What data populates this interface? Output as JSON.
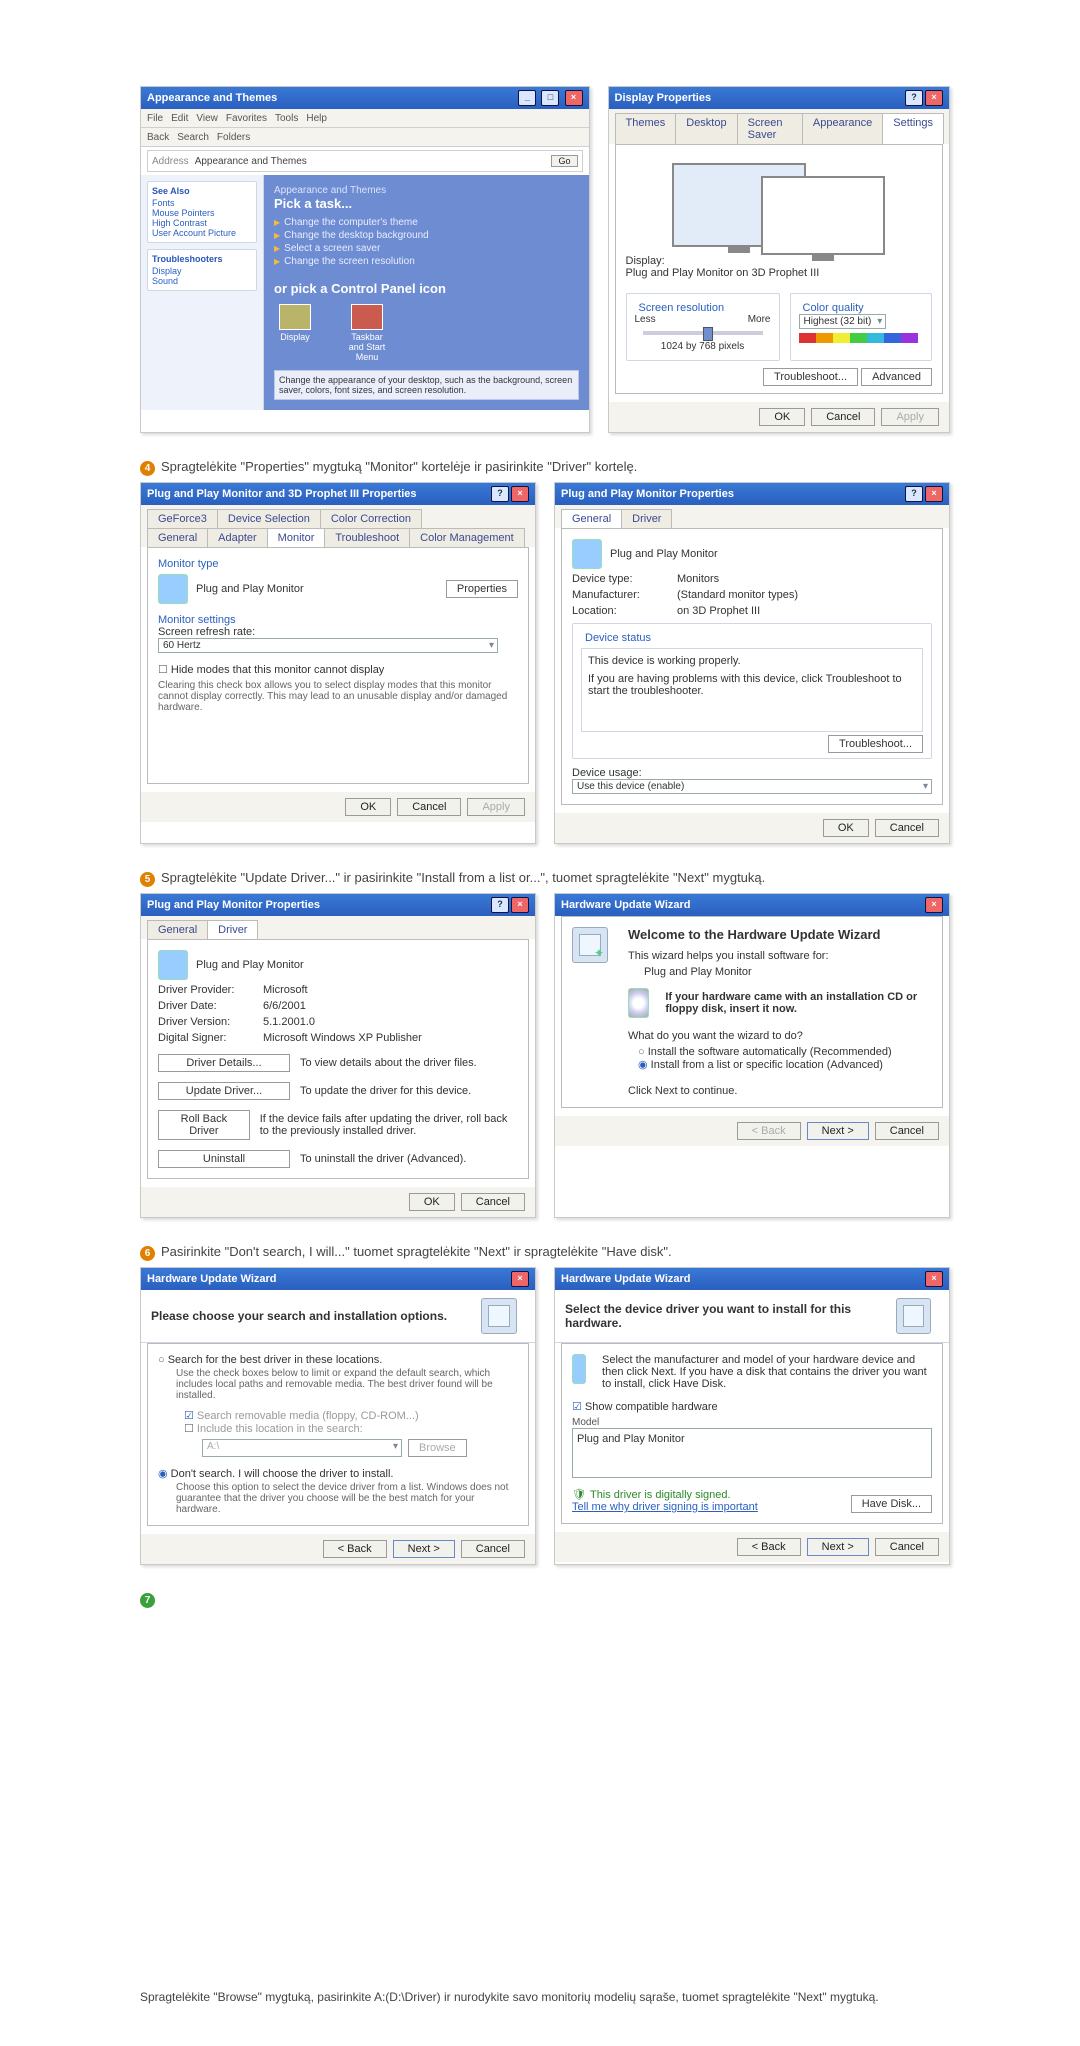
{
  "step4": "Spragtelėkite \"Properties\" mygtuką \"Monitor\" kortelėje ir pasirinkite \"Driver\" kortelę.",
  "step5": "Spragtelėkite \"Update Driver...\" ir pasirinkite \"Install from a list or...\", tuomet spragtelėkite \"Next\" mygtuką.",
  "step6": "Pasirinkite \"Don't search, I will...\" tuomet spragtelėkite \"Next\" ir spragtelėkite \"Have disk\".",
  "step7_footer": "Spragtelėkite \"Browse\" mygtuką, pasirinkite A:(D:\\Driver) ir nurodykite savo monitorių modelių sąraše, tuomet spragtelėkite \"Next\" mygtuką.",
  "explorer": {
    "title": "Appearance and Themes",
    "menu": [
      "File",
      "Edit",
      "View",
      "Favorites",
      "Tools",
      "Help"
    ],
    "tb": [
      "Back",
      "Search",
      "Folders"
    ],
    "addr_label": "Address",
    "addr": "Appearance and Themes",
    "go": "Go",
    "see_also": "See Also",
    "see_items": [
      "Fonts",
      "Mouse Pointers",
      "High Contrast",
      "User Account Picture"
    ],
    "trouble": "Troubleshooters",
    "trouble_items": [
      "Display",
      "Sound"
    ],
    "heading": "Appearance and Themes",
    "pick": "Pick a task...",
    "tasks": [
      "Change the computer's theme",
      "Change the desktop background",
      "Select a screen saver",
      "Change the screen resolution"
    ],
    "or": "or pick a Control Panel icon",
    "icons": [
      "Display",
      "Taskbar and Start Menu"
    ],
    "tip_icon": "Change the appearance of your desktop, such as the background, screen saver, colors, font sizes, and screen resolution."
  },
  "display_props": {
    "title": "Display Properties",
    "tabs": [
      "Themes",
      "Desktop",
      "Screen Saver",
      "Appearance",
      "Settings"
    ],
    "display": "Display:",
    "display_val": "Plug and Play Monitor on 3D Prophet III",
    "res": "Screen resolution",
    "less": "Less",
    "more": "More",
    "res_val": "1024 by 768 pixels",
    "cq": "Color quality",
    "cq_val": "Highest (32 bit)",
    "troubleshoot": "Troubleshoot...",
    "advanced": "Advanced",
    "ok": "OK",
    "cancel": "Cancel",
    "apply": "Apply"
  },
  "pnp_props": {
    "title": "Plug and Play Monitor and 3D Prophet III Properties",
    "tabs_top": [
      "GeForce3",
      "Device Selection",
      "Color Correction"
    ],
    "tabs_bot": [
      "General",
      "Adapter",
      "Monitor",
      "Troubleshoot",
      "Color Management"
    ],
    "mt": "Monitor type",
    "mt_val": "Plug and Play Monitor",
    "props": "Properties",
    "ms": "Monitor settings",
    "srr": "Screen refresh rate:",
    "srr_val": "60 Hertz",
    "hide": "Hide modes that this monitor cannot display",
    "hide_note": "Clearing this check box allows you to select display modes that this monitor cannot display correctly. This may lead to an unusable display and/or damaged hardware.",
    "ok": "OK",
    "cancel": "Cancel",
    "apply": "Apply"
  },
  "pnp_mon": {
    "title": "Plug and Play Monitor Properties",
    "tabs": [
      "General",
      "Driver"
    ],
    "name": "Plug and Play Monitor",
    "dt": "Device type:",
    "dt_v": "Monitors",
    "mf": "Manufacturer:",
    "mf_v": "(Standard monitor types)",
    "loc": "Location:",
    "loc_v": "on 3D Prophet III",
    "ds": "Device status",
    "ds_v": "This device is working properly.",
    "ds_note": "If you are having problems with this device, click Troubleshoot to start the troubleshooter.",
    "tshoot": "Troubleshoot...",
    "du": "Device usage:",
    "du_v": "Use this device (enable)",
    "ok": "OK",
    "cancel": "Cancel"
  },
  "drv": {
    "title": "Plug and Play Monitor Properties",
    "tabs": [
      "General",
      "Driver"
    ],
    "name": "Plug and Play Monitor",
    "dp": "Driver Provider:",
    "dp_v": "Microsoft",
    "dd": "Driver Date:",
    "dd_v": "6/6/2001",
    "dv": "Driver Version:",
    "dv_v": "5.1.2001.0",
    "ds": "Digital Signer:",
    "ds_v": "Microsoft Windows XP Publisher",
    "b1": "Driver Details...",
    "b1t": "To view details about the driver files.",
    "b2": "Update Driver...",
    "b2t": "To update the driver for this device.",
    "b3": "Roll Back Driver",
    "b3t": "If the device fails after updating the driver, roll back to the previously installed driver.",
    "b4": "Uninstall",
    "b4t": "To uninstall the driver (Advanced).",
    "ok": "OK",
    "cancel": "Cancel"
  },
  "wiz1": {
    "title": "Hardware Update Wizard",
    "h": "Welcome to the Hardware Update Wizard",
    "sub": "This wizard helps you install software for:",
    "dev": "Plug and Play Monitor",
    "cd": "If your hardware came with an installation CD or floppy disk, insert it now.",
    "q": "What do you want the wizard to do?",
    "r1": "Install the software automatically (Recommended)",
    "r2": "Install from a list or specific location (Advanced)",
    "cont": "Click Next to continue.",
    "back": "< Back",
    "next": "Next >",
    "cancel": "Cancel"
  },
  "wiz2": {
    "title": "Hardware Update Wizard",
    "h": "Please choose your search and installation options.",
    "r1": "Search for the best driver in these locations.",
    "r1_note": "Use the check boxes below to limit or expand the default search, which includes local paths and removable media. The best driver found will be installed.",
    "c1": "Search removable media (floppy, CD-ROM...)",
    "c2": "Include this location in the search:",
    "path": "A:\\",
    "browse": "Browse",
    "r2": "Don't search. I will choose the driver to install.",
    "r2_note": "Choose this option to select the device driver from a list. Windows does not guarantee that the driver you choose will be the best match for your hardware.",
    "back": "< Back",
    "next": "Next >",
    "cancel": "Cancel"
  },
  "wiz3": {
    "title": "Hardware Update Wizard",
    "h": "Select the device driver you want to install for this hardware.",
    "note": "Select the manufacturer and model of your hardware device and then click Next. If you have a disk that contains the driver you want to install, click Have Disk.",
    "compat": "Show compatible hardware",
    "model": "Model",
    "item": "Plug and Play Monitor",
    "sign": "This driver is digitally signed.",
    "tell": "Tell me why driver signing is important",
    "have": "Have Disk...",
    "back": "< Back",
    "next": "Next >",
    "cancel": "Cancel"
  }
}
